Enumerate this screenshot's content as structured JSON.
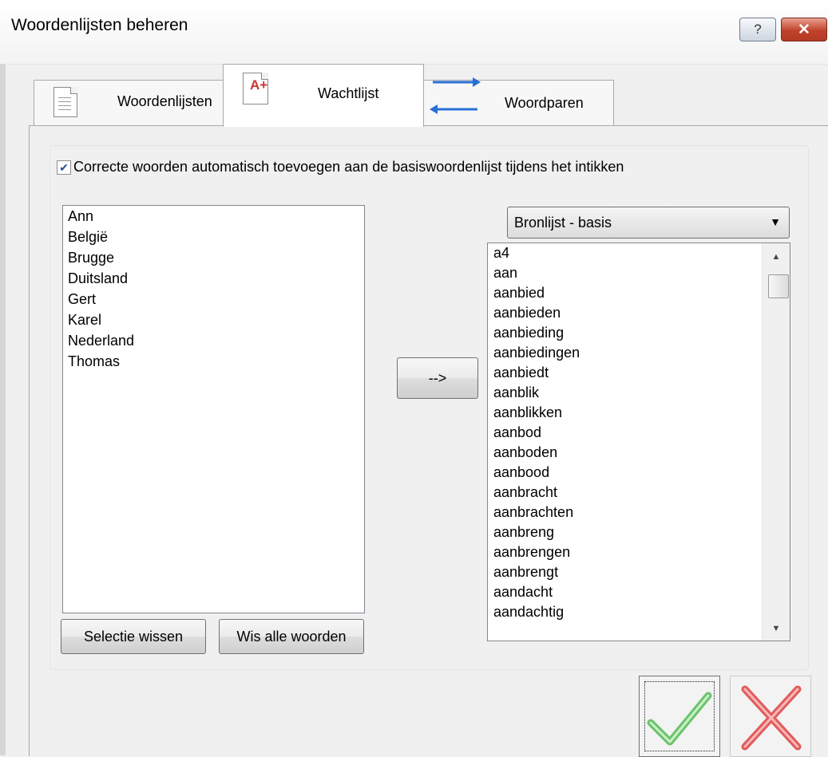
{
  "window": {
    "title": "Woordenlijsten beheren",
    "help_glyph": "?",
    "close_glyph": "✕"
  },
  "tabs": [
    {
      "label": "Woordenlijsten",
      "icon": "document-icon"
    },
    {
      "label": "Wachtlijst",
      "icon": "a-plus-document-icon",
      "active": true
    },
    {
      "label": "Woordparen",
      "icon": "swap-arrows-icon"
    }
  ],
  "options": {
    "auto_add_label": "Correcte woorden automatisch toevoegen aan de basiswoordenlijst tijdens het intikken",
    "auto_add_checked": true
  },
  "wait_list": {
    "items": [
      "Ann",
      "België",
      "Brugge",
      "Duitsland",
      "Gert",
      "Karel",
      "Nederland",
      "Thomas"
    ]
  },
  "move_button": "-->",
  "source": {
    "selected": "Bronlijst - basis",
    "items": [
      "a4",
      "aan",
      "aanbied",
      "aanbieden",
      "aanbieding",
      "aanbiedingen",
      "aanbiedt",
      "aanblik",
      "aanblikken",
      "aanbod",
      "aanboden",
      "aanbood",
      "aanbracht",
      "aanbrachten",
      "aanbreng",
      "aanbrengen",
      "aanbrengt",
      "aandacht",
      "aandachtig"
    ]
  },
  "buttons": {
    "clear_selection": "Selectie wissen",
    "clear_all": "Wis alle woorden"
  },
  "colors": {
    "ok_check": "#6cc36c",
    "cancel_x": "#e25b5b",
    "tab_arrow": "#2a6fd6"
  }
}
